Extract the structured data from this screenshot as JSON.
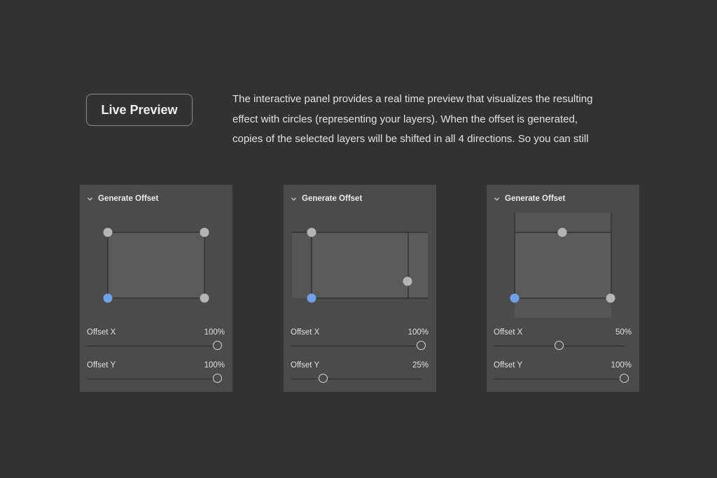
{
  "live_preview_label": "Live Preview",
  "description_lines": [
    "The interactive panel provides a real time preview that visualizes the resulting",
    "effect with circles (representing your layers). When the offset is generated,",
    "copies of the selected layers will be shifted in all 4 directions. So you can still"
  ],
  "colors": {
    "background": "#323232",
    "panel": "#4b4b4b",
    "layer_fill": "#5a5a5a",
    "selected_handle": "#6fa0ea",
    "handle": "#b4b4b4"
  },
  "panels": [
    {
      "title": "Generate Offset",
      "offset_x": {
        "label": "Offset X",
        "value_text": "100%",
        "value": 1.0
      },
      "offset_y": {
        "label": "Offset Y",
        "value_text": "100%",
        "value": 1.0
      }
    },
    {
      "title": "Generate Offset",
      "offset_x": {
        "label": "Offset X",
        "value_text": "100%",
        "value": 1.0
      },
      "offset_y": {
        "label": "Offset Y",
        "value_text": "25%",
        "value": 0.25
      }
    },
    {
      "title": "Generate Offset",
      "offset_x": {
        "label": "Offset X",
        "value_text": "50%",
        "value": 0.5
      },
      "offset_y": {
        "label": "Offset Y",
        "value_text": "100%",
        "value": 1.0
      }
    }
  ]
}
